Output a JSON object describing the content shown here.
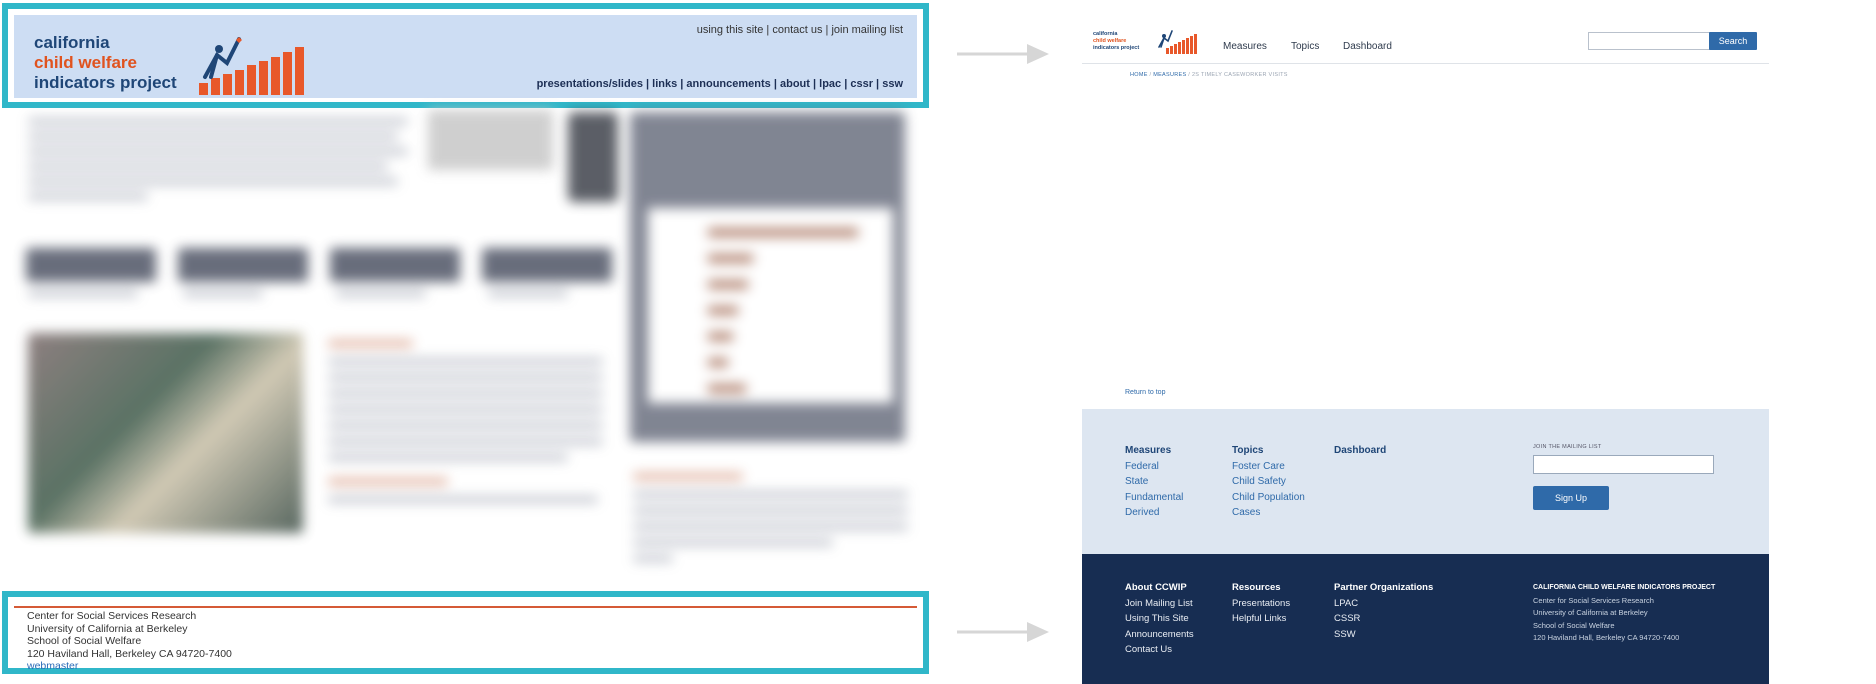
{
  "colors": {
    "highlight_frame": "#30b7c9",
    "old_header_bg": "#cdddf3",
    "brand_blue": "#1f4677",
    "brand_orange": "#e0531f",
    "accent_blue": "#2f6aa9",
    "footer_navy": "#172d52",
    "mid_band": "#dde6f1"
  },
  "old_site": {
    "logo": {
      "line1": "california",
      "line2": "child welfare",
      "line3": "indicators project",
      "icon": "reaching-figure-bar-chart-icon"
    },
    "utility_links": [
      "using this site",
      "contact us",
      "join mailing list"
    ],
    "utility_sep": " | ",
    "main_nav": [
      "presentations/slides",
      "links",
      "announcements",
      "about",
      "lpac",
      "cssr",
      "ssw"
    ],
    "footer": {
      "line1": "Center for Social Services Research",
      "line2": "University of California at Berkeley",
      "line3": "School of Social Welfare",
      "line4": "120 Haviland Hall, Berkeley CA 94720-7400",
      "link": "webmaster"
    }
  },
  "arrows": [
    "arrow-right-icon",
    "arrow-right-icon"
  ],
  "new_site": {
    "logo": {
      "line1": "california",
      "line2": "child welfare",
      "line3": "indicators project",
      "icon": "reaching-figure-bar-chart-icon"
    },
    "nav": [
      "Measures",
      "Topics",
      "Dashboard"
    ],
    "search": {
      "placeholder": "",
      "button": "Search"
    },
    "breadcrumb": {
      "home": "HOME",
      "measures": "MEASURES",
      "current": "2S TIMELY CASEWORKER VISITS",
      "sep": "/"
    },
    "return_to_top": "Return to top",
    "footer_nav": {
      "measures": {
        "title": "Measures",
        "items": [
          "Federal",
          "State",
          "Fundamental",
          "Derived"
        ]
      },
      "topics": {
        "title": "Topics",
        "items": [
          "Foster Care",
          "Child Safety",
          "Child Population",
          "Cases"
        ]
      },
      "dashboard": {
        "title": "Dashboard"
      }
    },
    "mailing": {
      "label": "JOIN THE MAILING LIST",
      "button": "Sign Up"
    },
    "footer": {
      "about": {
        "title": "About CCWIP",
        "items": [
          "Join Mailing List",
          "Using This Site",
          "Announcements",
          "Contact Us"
        ]
      },
      "resources": {
        "title": "Resources",
        "items": [
          "Presentations",
          "Helpful Links"
        ]
      },
      "partners": {
        "title": "Partner Organizations",
        "items": [
          "LPAC",
          "CSSR",
          "SSW"
        ]
      },
      "address": {
        "title": "CALIFORNIA CHILD WELFARE INDICATORS PROJECT",
        "line1": "Center for Social Services Research",
        "line2": "University of California at Berkeley",
        "line3": "School of Social Welfare",
        "line4": "120 Haviland Hall, Berkeley CA 94720-7400"
      }
    }
  }
}
